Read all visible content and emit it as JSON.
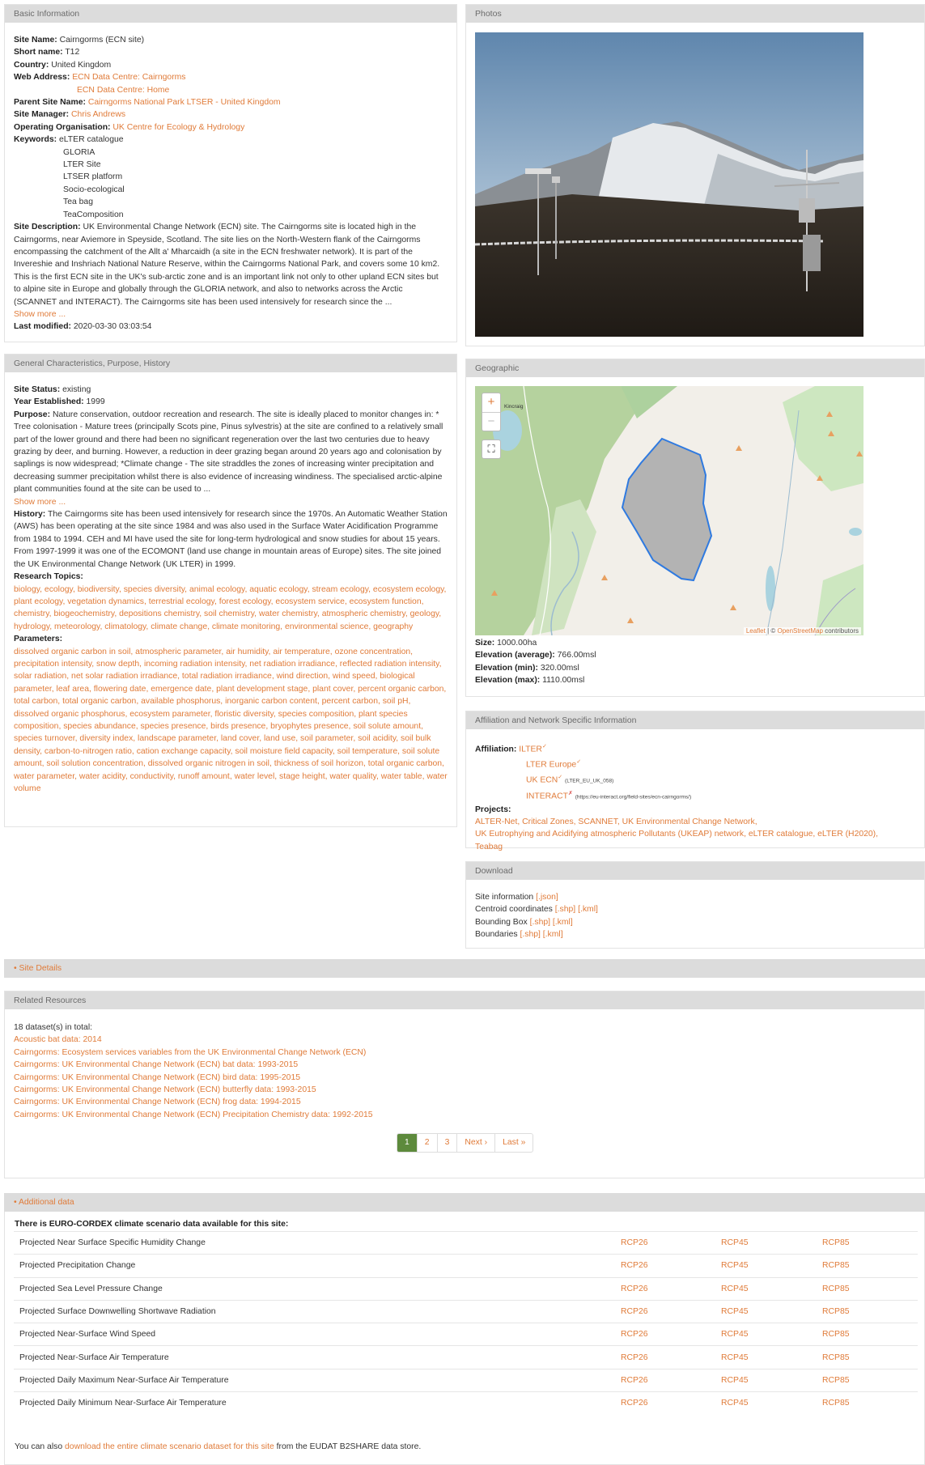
{
  "basic": {
    "heading": "Basic Information",
    "site_name_label": "Site Name:",
    "site_name": "Cairngorms (ECN site)",
    "short_name_label": "Short name:",
    "short_name": "T12",
    "country_label": "Country:",
    "country": "United Kingdom",
    "web_address_label": "Web Address:",
    "web_links": [
      "ECN Data Centre: Cairngorms",
      "ECN Data Centre: Home"
    ],
    "parent_label": "Parent Site Name:",
    "parent": "Cairngorms National Park LTSER - United Kingdom",
    "manager_label": "Site Manager:",
    "manager": "Chris Andrews",
    "org_label": "Operating Organisation:",
    "org": "UK Centre for Ecology & Hydrology",
    "keywords_label": "Keywords:",
    "keywords": [
      "eLTER catalogue",
      "GLORIA",
      "LTER Site",
      "LTSER platform",
      "Socio-ecological",
      "Tea bag",
      "TeaComposition"
    ],
    "description_label": "Site Description:",
    "description": "UK Environmental Change Network (ECN) site. The Cairngorms site is located high in the Cairngorms, near Aviemore in Speyside, Scotland. The site lies on the North-Western flank of the Cairngorms encompassing the catchment of the Allt a' Mharcaidh (a site in the ECN freshwater network). It is part of the Invereshie and Inshriach National Nature Reserve, within the Cairngorms National Park, and covers some 10 km2. This is the first ECN site in the UK's sub-arctic zone and is an important link not only to other upland ECN sites but to alpine site in Europe and globally through the GLORIA network, and also to networks across the Arctic (SCANNET and INTERACT). The Cairngorms site has been used intensively for research since the ...",
    "show_more": "Show more ...",
    "modified_label": "Last modified:",
    "modified": "2020-03-30 03:03:54"
  },
  "photos": {
    "heading": "Photos"
  },
  "general": {
    "heading": "General Characteristics, Purpose, History",
    "status_label": "Site Status:",
    "status": "existing",
    "year_label": "Year Established:",
    "year": "1999",
    "purpose_label": "Purpose:",
    "purpose": "Nature conservation, outdoor recreation and research. The site is ideally placed to monitor changes in: * Tree colonisation - Mature trees (principally Scots pine, Pinus sylvestris) at the site are confined to a relatively small part of the lower ground and there had been no significant regeneration over the last two centuries due to heavy grazing by deer, and burning. However, a reduction in deer grazing began around 20 years ago and colonisation by saplings is now widespread; *Climate change - The site straddles the zones of increasing winter precipitation and decreasing summer precipitation whilst there is also evidence of increasing windiness. The specialised arctic-alpine plant communities found at the site can be used to ...",
    "show_more": "Show more ...",
    "history_label": "History:",
    "history": "The Cairngorms site has been used intensively for research since the 1970s. An Automatic Weather Station (AWS) has been operating at the site since 1984 and was also used in the Surface Water Acidification Programme from 1984 to 1994. CEH and MI have used the site for long-term hydrological and snow studies for about 15 years. From 1997-1999 it was one of the ECOMONT (land use change in mountain areas of Europe) sites. The site joined the UK Environmental Change Network (UK LTER) in 1999.",
    "topics_label": "Research Topics:",
    "topics": "biology, ecology, biodiversity, species diversity, animal ecology, aquatic ecology, stream ecology, ecosystem ecology, plant ecology, vegetation dynamics, terrestrial ecology, forest ecology, ecosystem service, ecosystem function, chemistry, biogeochemistry, depositions chemistry, soil chemistry, water chemistry, atmospheric chemistry, geology, hydrology, meteorology, climatology, climate change, climate monitoring, environmental science, geography",
    "params_label": "Parameters:",
    "params": "dissolved organic carbon in soil, atmospheric parameter, air humidity, air temperature, ozone concentration, precipitation intensity, snow depth, incoming radiation intensity, net radiation irradiance, reflected radiation intensity, solar radiation, net solar radiation irradiance, total radiation irradiance, wind direction, wind speed, biological parameter, leaf area, flowering date, emergence date, plant development stage, plant cover, percent organic carbon, total carbon, total organic carbon, available phosphorus, inorganic carbon content, percent carbon, soil pH, dissolved organic phosphorus, ecosystem parameter, floristic diversity, species composition, plant species composition, species abundance, species presence, birds presence, bryophytes presence, soil solute amount, species turnover, diversity index, landscape parameter, land cover, land use, soil parameter, soil acidity, soil bulk density, carbon-to-nitrogen ratio, cation exchange capacity, soil moisture field capacity, soil temperature, soil solute amount, soil solution concentration, dissolved organic nitrogen in soil, thickness of soil horizon, total organic carbon, water parameter, water acidity, conductivity, runoff amount, water level, stage height, water quality, water table, water volume"
  },
  "geo": {
    "heading": "Geographic",
    "zoom_in": "+",
    "zoom_out": "−",
    "fullscreen": "⛶",
    "attribution_leaflet": "Leaflet",
    "attribution_sep": " | © ",
    "attribution_osm": "OpenStreetMap",
    "attribution_tail": " contributors",
    "place_label": "Kincraig",
    "size_label": "Size:",
    "size": "1000.00ha",
    "elev_avg_label": "Elevation (average):",
    "elev_avg": "766.00msl",
    "elev_min_label": "Elevation (min):",
    "elev_min": "320.00msl",
    "elev_max_label": "Elevation (max):",
    "elev_max": "1110.00msl"
  },
  "affiliation": {
    "heading": "Affiliation and Network Specific Information",
    "label": "Affiliation:",
    "items": [
      {
        "name": "ILTER",
        "mark": "✓",
        "extra": ""
      },
      {
        "name": "LTER Europe",
        "mark": "✓",
        "extra": ""
      },
      {
        "name": "UK ECN",
        "mark": "✓",
        "extra": "(LTER_EU_UK_058)"
      },
      {
        "name": "INTERACT",
        "mark": "✗",
        "extra": "(https://eu-interact.org/field-sites/ecn-cairngorms/)"
      }
    ],
    "projects_label": "Projects:",
    "projects_line1": "ALTER-Net, Critical Zones, SCANNET, UK Environmental Change Network,",
    "projects_line2": "UK Eutrophying and Acidifying atmospheric Pollutants (UKEAP) network, eLTER catalogue, eLTER (H2020),",
    "projects_line3": "Teabag"
  },
  "download": {
    "heading": "Download",
    "rows": [
      {
        "label": "Site information",
        "links": "[.json]"
      },
      {
        "label": "Centroid coordinates",
        "links": "[.shp] [.kml]"
      },
      {
        "label": "Bounding Box",
        "links": "[.shp] [.kml]"
      },
      {
        "label": "Boundaries",
        "links": "[.shp] [.kml]"
      }
    ]
  },
  "site_details": "• Site Details",
  "related": {
    "heading": "Related Resources",
    "count": "18 dataset(s) in total:",
    "items": [
      "Acoustic bat data: 2014",
      "Cairngorms: Ecosystem services variables from the UK Environmental Change Network (ECN)",
      "Cairngorms: UK Environmental Change Network (ECN) bat data: 1993-2015",
      "Cairngorms: UK Environmental Change Network (ECN) bird data: 1995-2015",
      "Cairngorms: UK Environmental Change Network (ECN) butterfly data: 1993-2015",
      "Cairngorms: UK Environmental Change Network (ECN) frog data: 1994-2015",
      "Cairngorms: UK Environmental Change Network (ECN) Precipitation Chemistry data: 1992-2015"
    ],
    "pages": [
      "1",
      "2",
      "3",
      "Next ›",
      "Last »"
    ]
  },
  "additional": {
    "heading": "• Additional data",
    "intro": "There is EURO-CORDEX climate scenario data available for this site:",
    "rows": [
      [
        "Projected Near Surface Specific Humidity Change",
        "RCP26",
        "RCP45",
        "RCP85"
      ],
      [
        "Projected Precipitation Change",
        "RCP26",
        "RCP45",
        "RCP85"
      ],
      [
        "Projected Sea Level Pressure Change",
        "RCP26",
        "RCP45",
        "RCP85"
      ],
      [
        "Projected Surface Downwelling Shortwave Radiation",
        "RCP26",
        "RCP45",
        "RCP85"
      ],
      [
        "Projected Near-Surface Wind Speed",
        "RCP26",
        "RCP45",
        "RCP85"
      ],
      [
        "Projected Near-Surface Air Temperature",
        "RCP26",
        "RCP45",
        "RCP85"
      ],
      [
        "Projected Daily Maximum Near-Surface Air Temperature",
        "RCP26",
        "RCP45",
        "RCP85"
      ],
      [
        "Projected Daily Minimum Near-Surface Air Temperature",
        "RCP26",
        "RCP45",
        "RCP85"
      ]
    ],
    "footer_pre": "You can also ",
    "footer_link": "download the entire climate scenario dataset for this site",
    "footer_post": " from the EUDAT B2SHARE data store."
  },
  "colors": {
    "link": "#e07b39",
    "header": "#dcdcdc",
    "pager_active": "#5d8a3c",
    "polygon_fill": "#b3b3b3",
    "polygon_stroke": "#2f7ae0"
  }
}
